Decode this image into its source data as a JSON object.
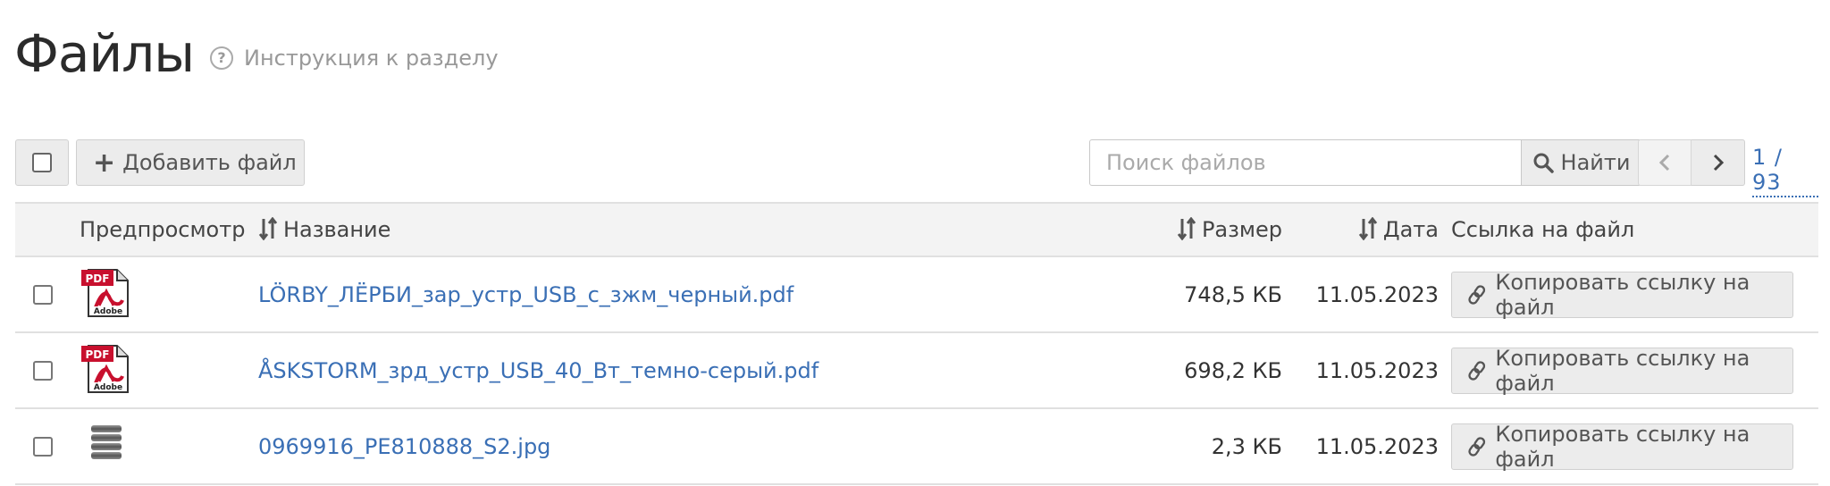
{
  "page": {
    "title": "Файлы",
    "help_link": "Инструкция к разделу"
  },
  "toolbar": {
    "add_file_label": "Добавить файл",
    "search_placeholder": "Поиск файлов",
    "search_button_label": "Найти",
    "page_counter": "1 / 93"
  },
  "table": {
    "headers": {
      "preview": "Предпросмотр",
      "name": "Название",
      "size": "Размер",
      "date": "Дата",
      "link": "Ссылка на файл"
    },
    "rows": [
      {
        "icon": "pdf-file-icon",
        "name": "LÖRBY_ЛЁРБИ_зар_устр_USB_с_зжм_черный.pdf",
        "size": "748,5 КБ",
        "date": "11.05.2023",
        "copy_label": "Копировать ссылку на файл"
      },
      {
        "icon": "pdf-file-icon",
        "name": "ÅSKSTORM_зрд_устр_USB_40_Вт_темно-серый.pdf",
        "size": "698,2 КБ",
        "date": "11.05.2023",
        "copy_label": "Копировать ссылку на файл"
      },
      {
        "icon": "image-thumbnail-icon",
        "name": "0969916_PE810888_S2.jpg",
        "size": "2,3 КБ",
        "date": "11.05.2023",
        "copy_label": "Копировать ссылку на файл"
      }
    ]
  },
  "colors": {
    "link": "#3a6fb5",
    "button_bg": "#ececec",
    "header_bg": "#f3f3f3",
    "pdf_red": "#c8102e"
  }
}
